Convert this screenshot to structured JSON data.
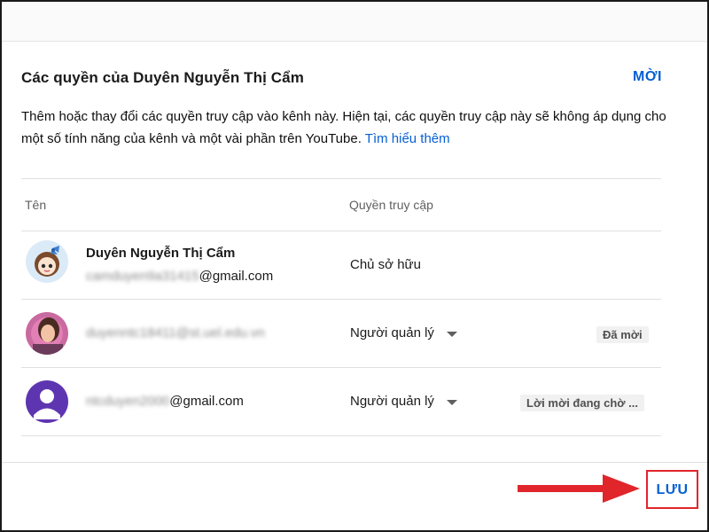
{
  "dialog": {
    "title": "Các quyền của Duyên Nguyễn Thị Cẩm",
    "invite_label": "MỜI",
    "description": "Thêm hoặc thay đổi các quyền truy cập vào kênh này. Hiện tại, các quyền truy cập này sẽ không áp dụng cho một số tính năng của kênh và một vài phần trên YouTube.",
    "learn_more": "Tìm hiểu thêm"
  },
  "table": {
    "headers": {
      "name": "Tên",
      "access": "Quyền truy cập"
    },
    "rows": [
      {
        "name": "Duyên Nguyễn Thị Cẩm",
        "email_blurred": "camduyen9a31415",
        "email_domain": "@gmail.com",
        "role": "Chủ sở hữu",
        "status": ""
      },
      {
        "name": "",
        "email_blurred": "duyenntc18411@st.uel.edu.vn",
        "email_domain": "",
        "role": "Người quản lý",
        "status": "Đã mời"
      },
      {
        "name": "",
        "email_blurred": "ntcduyen2000",
        "email_domain": "@gmail.com",
        "role": "Người quản lý",
        "status": "Lời mời đang chờ ..."
      }
    ]
  },
  "footer": {
    "save_label": "LƯU"
  },
  "colors": {
    "link": "#065fd4",
    "highlight": "#e0252b",
    "avatar_purple": "#5e35b1"
  },
  "icons": {
    "dropdown": "caret-down-icon",
    "arrow": "right-arrow-icon",
    "default_avatar": "person-icon"
  }
}
